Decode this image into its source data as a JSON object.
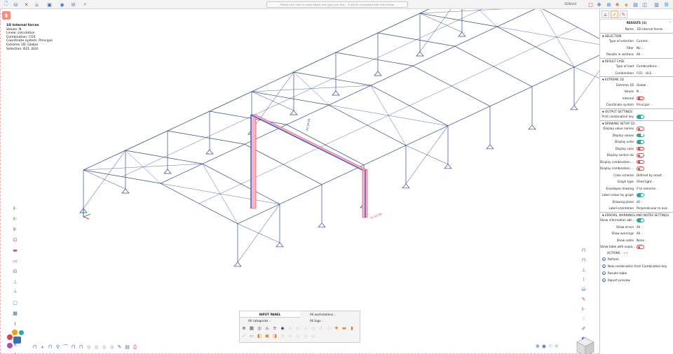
{
  "topbar": {
    "command_placeholder": "Please click here or press Space and type your text... it will be completed with lines below.",
    "user": "SDWorld"
  },
  "viewport_info": {
    "title": "1D internal forces",
    "lines": [
      "Values: N",
      "Linear calculation",
      "Combination: CO1",
      "Coordinate system: Principal",
      "Extreme 1D: Global",
      "Selection: B21..B24"
    ]
  },
  "result_labels": {
    "top": "-70.18 kN",
    "bottom": "-71.52 kN"
  },
  "input_panel": {
    "title": "INPUT PANEL",
    "workstations": "All workstations",
    "categories": "All categories",
    "tags": "All tags"
  },
  "results_panel": {
    "header": "RESULTS (1)",
    "name_label": "Name",
    "name_value": "1D internal forces",
    "sections": {
      "selection": "SELECTION",
      "result_case": "RESULT CASE",
      "extreme": "EXTREME 1D",
      "output": "OUTPUT SETTINGS",
      "drawing": "DRAWING SETUP 1D",
      "errors": "ERRORS, WARNINGS AND NOTES SETTINGS"
    },
    "selection_rows": [
      {
        "label": "Type of selection",
        "value": "Current"
      },
      {
        "label": "Filter",
        "value": "No"
      },
      {
        "label": "Results in sections",
        "value": "All"
      }
    ],
    "result_case_rows": [
      {
        "label": "Type of load",
        "value": "Combinations"
      },
      {
        "label": "Combination",
        "value": "CO1 - ULS"
      }
    ],
    "extreme_rows": [
      {
        "label": "Extreme 1D",
        "value": "Global"
      },
      {
        "label": "Values",
        "value": "N"
      },
      {
        "label": "Internal",
        "value": ""
      },
      {
        "label": "Coordinate system",
        "value": "Principal"
      }
    ],
    "output_rows": [
      {
        "label": "Print combination key",
        "value": ""
      }
    ],
    "drawing_rows": [
      {
        "label": "Display value names",
        "value": ""
      },
      {
        "label": "Display values",
        "value": ""
      },
      {
        "label": "Display units",
        "value": ""
      },
      {
        "label": "Display case",
        "value": ""
      },
      {
        "label": "Display section dx",
        "value": ""
      },
      {
        "label": "Display combination ...",
        "value": ""
      },
      {
        "label": "Display combination ...",
        "value": ""
      },
      {
        "label": "Color scheme",
        "value": "Defined by result"
      },
      {
        "label": "Graph type",
        "value": "Filled light"
      },
      {
        "label": "Envelopes drawing",
        "value": "0 to extreme"
      },
      {
        "label": "Label colour by graph",
        "value": ""
      },
      {
        "label": "Drawing plane",
        "value": "z0"
      },
      {
        "label": "Label orientation",
        "value": "Perpendicular to axis"
      }
    ],
    "errors_rows": [
      {
        "label": "Show information abt...",
        "value": ""
      },
      {
        "label": "Show errors",
        "value": "All"
      },
      {
        "label": "Show warnings",
        "value": "All"
      },
      {
        "label": "Show notes",
        "value": "None"
      },
      {
        "label": "Show table with expla...",
        "value": ""
      }
    ],
    "actions_label": "ACTIONS",
    "actions_suffix": ">>",
    "actions": [
      "Refresh",
      "New combination from Combination key",
      "Results table",
      "Report preview"
    ]
  },
  "colors": {
    "accent": "#2aa8a1",
    "structure": "#2f4a8a",
    "result_fill": "#ff6b7a",
    "highlight": "#e23b4f"
  }
}
